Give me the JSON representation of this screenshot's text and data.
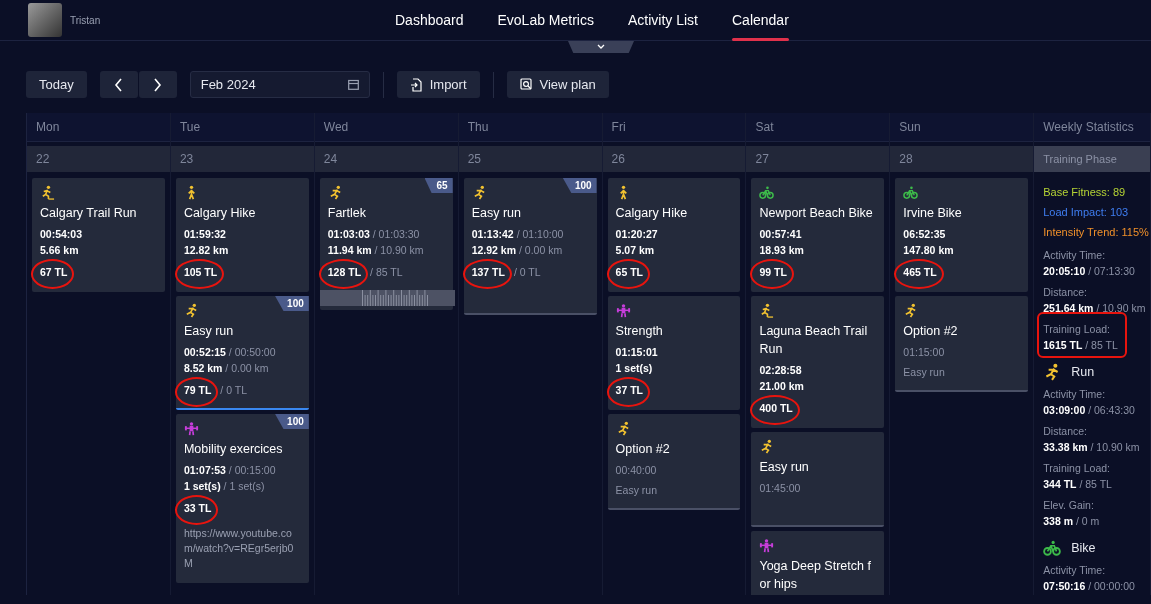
{
  "user": {
    "name": "Tristan"
  },
  "nav": [
    {
      "label": "Dashboard",
      "selected": false
    },
    {
      "label": "EvoLab Metrics",
      "selected": false
    },
    {
      "label": "Activity List",
      "selected": false
    },
    {
      "label": "Calendar",
      "selected": true
    }
  ],
  "toolbar": {
    "today": "Today",
    "month": "Feb 2024",
    "import": "Import",
    "view_plan": "View plan"
  },
  "days": [
    {
      "weekday": "Mon",
      "date": "22",
      "cards": [
        {
          "kind": "trail-run",
          "planned": false,
          "title": "Calgary Trail Run",
          "lines": [
            {
              "value": "00:54:03"
            },
            {
              "value": "5.66 km"
            }
          ],
          "tl": {
            "value": "67 TL"
          },
          "circled": true
        }
      ]
    },
    {
      "weekday": "Tue",
      "date": "23",
      "cards": [
        {
          "kind": "hike",
          "planned": false,
          "title": "Calgary Hike",
          "lines": [
            {
              "value": "01:59:32"
            },
            {
              "value": "12.82 km"
            }
          ],
          "tl": {
            "value": "105 TL"
          },
          "circled": true
        },
        {
          "kind": "run",
          "planned": false,
          "title": "Easy run",
          "badge": "100",
          "accent": true,
          "lines": [
            {
              "value": "00:52:15",
              "target": "/ 00:50:00"
            },
            {
              "value": "8.52 km",
              "target": "/ 0.00 km"
            }
          ],
          "tl": {
            "value": "79 TL",
            "target": "/ 0 TL"
          },
          "circled": true
        },
        {
          "kind": "strength",
          "planned": false,
          "title": "Mobility exercices",
          "badge": "100",
          "lines": [
            {
              "value": "01:07:53",
              "target": "/ 00:15:00"
            },
            {
              "value": "1 set(s)",
              "target": "/ 1 set(s)"
            }
          ],
          "tl": {
            "value": "33 TL"
          },
          "circled": true,
          "note": "https://www.youtube.com/watch?v=REgr5erjb0M"
        }
      ]
    },
    {
      "weekday": "Wed",
      "date": "24",
      "cards": [
        {
          "kind": "run",
          "planned": false,
          "title": "Fartlek",
          "badge": "65",
          "trace": true,
          "lines": [
            {
              "value": "01:03:03",
              "target": "/ 01:03:30"
            },
            {
              "value": "11.94 km",
              "target": "/ 10.90 km"
            }
          ],
          "tl": {
            "value": "128 TL",
            "target": "/ 85 TL"
          },
          "circled": true
        }
      ]
    },
    {
      "weekday": "Thu",
      "date": "25",
      "cards": [
        {
          "kind": "run",
          "planned": false,
          "title": "Easy run",
          "badge": "100",
          "lines": [
            {
              "value": "01:13:42",
              "target": "/ 01:10:00"
            },
            {
              "value": "12.92 km",
              "target": "/ 0.00 km"
            }
          ],
          "tl": {
            "value": "137 TL",
            "target": "/ 0 TL"
          },
          "circled": true
        }
      ]
    },
    {
      "weekday": "Fri",
      "date": "26",
      "cards": [
        {
          "kind": "hike",
          "planned": false,
          "title": "Calgary Hike",
          "lines": [
            {
              "value": "01:20:27"
            },
            {
              "value": "5.07 km"
            }
          ],
          "tl": {
            "value": "65 TL"
          },
          "circled": true
        },
        {
          "kind": "strength",
          "planned": false,
          "title": "Strength",
          "lines": [
            {
              "value": "01:15:01"
            },
            {
              "value": "1 set(s)"
            }
          ],
          "tl": {
            "value": "37 TL"
          },
          "circled": true
        },
        {
          "kind": "run",
          "planned": true,
          "title": "Option #2",
          "lines": [
            {
              "value": "00:40:00"
            }
          ],
          "note": "Easy run"
        }
      ]
    },
    {
      "weekday": "Sat",
      "date": "27",
      "cards": [
        {
          "kind": "bike",
          "planned": false,
          "title": "Newport Beach Bike",
          "lines": [
            {
              "value": "00:57:41"
            },
            {
              "value": "18.93 km"
            }
          ],
          "tl": {
            "value": "99 TL"
          },
          "circled": true
        },
        {
          "kind": "trail-run",
          "planned": false,
          "title": "Laguna Beach Trail Run",
          "lines": [
            {
              "value": "02:28:58"
            },
            {
              "value": "21.00 km"
            }
          ],
          "tl": {
            "value": "400 TL"
          },
          "circled": true
        },
        {
          "kind": "run",
          "planned": true,
          "title": "Easy run",
          "lines": [
            {
              "value": "01:45:00"
            }
          ]
        },
        {
          "kind": "strength",
          "title": "Yoga Deep Stretch for hips"
        }
      ]
    },
    {
      "weekday": "Sun",
      "date": "28",
      "cards": [
        {
          "kind": "bike",
          "planned": false,
          "title": "Irvine Bike",
          "lines": [
            {
              "value": "06:52:35"
            },
            {
              "value": "147.80 km"
            }
          ],
          "tl": {
            "value": "465 TL"
          },
          "circled": true
        },
        {
          "kind": "run",
          "planned": true,
          "title": "Option #2",
          "lines": [
            {
              "value": "01:15:00"
            }
          ],
          "note": "Easy run"
        }
      ]
    }
  ],
  "weekly": {
    "heading": "Weekly Statistics",
    "phase": "Training Phase",
    "metrics": [
      {
        "text": "Base Fitness: 89",
        "color": "#b5d334"
      },
      {
        "text": "Load Impact: 103",
        "color": "#3f7df0"
      },
      {
        "text": "Intensity Trend: 115%",
        "color": "#f0902a"
      }
    ],
    "stats": [
      {
        "label": "Activity Time:",
        "value": "20:05:10",
        "target": "/ 07:13:30",
        "circled": false
      },
      {
        "label": "Distance:",
        "value": "251.64 km",
        "target": "/ 10.90 km",
        "circled": false
      },
      {
        "label": "Training Load:",
        "value": "1615 TL",
        "target": "/ 85 TL",
        "circled": true
      }
    ],
    "sports": [
      {
        "kind": "run",
        "name": "Run",
        "stats": [
          {
            "label": "Activity Time:",
            "value": "03:09:00",
            "target": "/ 06:43:30"
          },
          {
            "label": "Distance:",
            "value": "33.38 km",
            "target": "/ 10.90 km"
          },
          {
            "label": "Training Load:",
            "value": "344 TL",
            "target": "/ 85 TL"
          },
          {
            "label": "Elev. Gain:",
            "value": "338 m",
            "target": "/ 0 m"
          }
        ]
      },
      {
        "kind": "bike",
        "name": "Bike",
        "stats": [
          {
            "label": "Activity Time:",
            "value": "07:50:16",
            "target": "/ 00:00:00"
          }
        ]
      }
    ]
  }
}
